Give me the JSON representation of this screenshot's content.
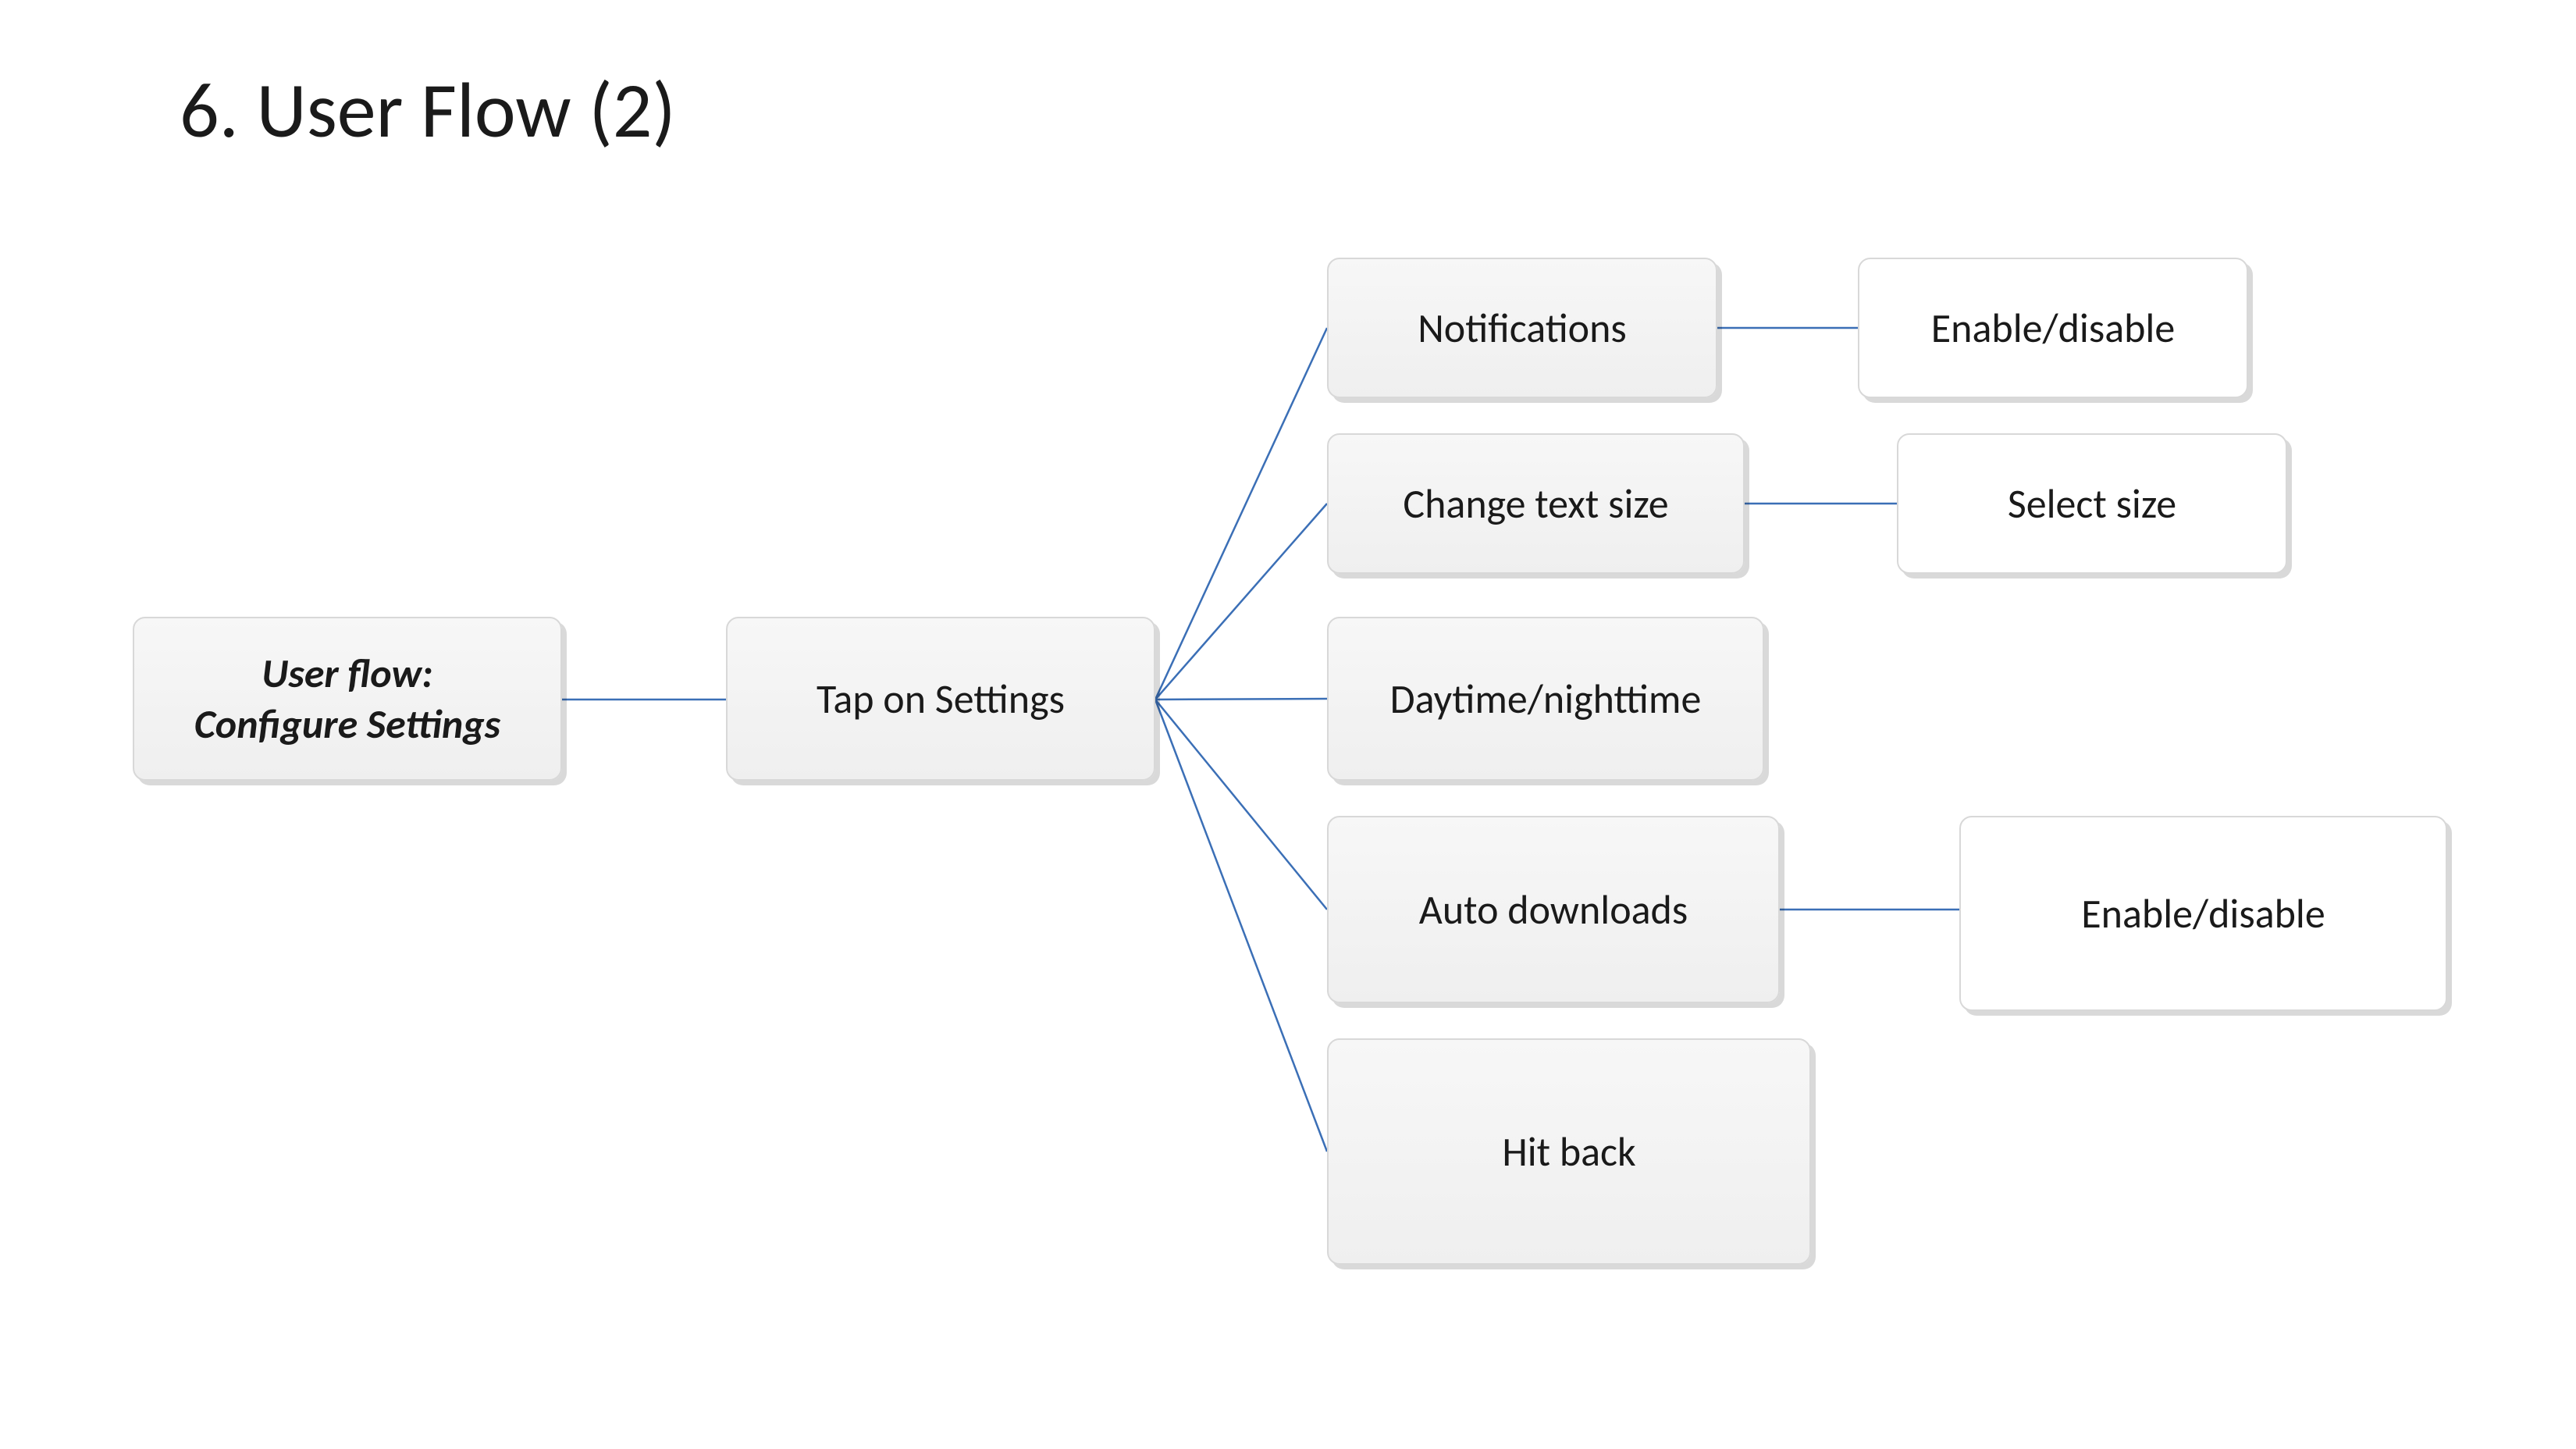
{
  "title": "6. User Flow (2)",
  "root": {
    "label": "User flow:\nConfigure Settings"
  },
  "step1": {
    "label": "Tap on Settings"
  },
  "options": [
    {
      "label": "Notifications",
      "action": "Enable/disable"
    },
    {
      "label": "Change text size",
      "action": "Select size"
    },
    {
      "label": "Daytime/nighttime",
      "action": null
    },
    {
      "label": "Auto downloads",
      "action": "Enable/disable"
    },
    {
      "label": "Hit back",
      "action": null
    }
  ]
}
